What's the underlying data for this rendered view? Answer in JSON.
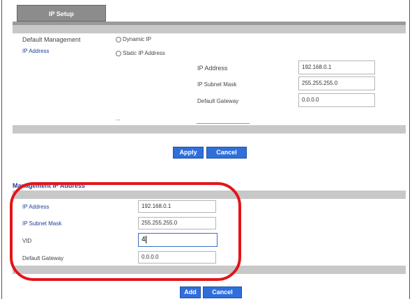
{
  "ip_setup": {
    "tab_label": "IP Setup",
    "default_management_label": "Default Management",
    "default_management_value": "Dynamic IP",
    "ip_address_label": "IP Address",
    "static_ip_option": "Static IP Address",
    "static_rows": [
      {
        "label": "IP Address",
        "value": "192.168.0.1"
      },
      {
        "label": "IP Subnet Mask",
        "value": "255.255.255.0"
      },
      {
        "label": "Default Gateway",
        "value": "0.0.0.0"
      }
    ],
    "vlan_marker": "...",
    "apply_label": "Apply",
    "cancel_label": "Cancel"
  },
  "management_ip_address": {
    "section_title": "Management IP Address",
    "rows": [
      {
        "label": "IP Address",
        "value": "192.168.0.1"
      },
      {
        "label": "IP Subnet Mask",
        "value": "255.255.255.0"
      },
      {
        "label": "VID",
        "value": "4"
      },
      {
        "label": "Default Gateway",
        "value": "0.0.0.0"
      }
    ],
    "add_label": "Add",
    "cancel_label": "Cancel"
  },
  "colors": {
    "highlight": "#e3141b",
    "button": "#2f6fdc",
    "section_title": "#1c3f99"
  }
}
